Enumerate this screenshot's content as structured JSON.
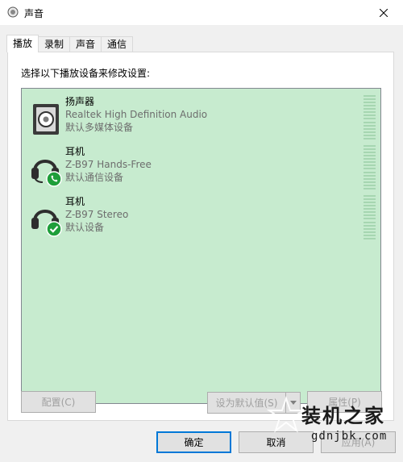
{
  "window": {
    "title": "声音"
  },
  "tabs": [
    {
      "label": "播放"
    },
    {
      "label": "录制"
    },
    {
      "label": "声音"
    },
    {
      "label": "通信"
    }
  ],
  "panel": {
    "instruction": "选择以下播放设备来修改设置:"
  },
  "devices": [
    {
      "name": "扬声器",
      "model": "Realtek High Definition Audio",
      "status": "默认多媒体设备",
      "icon": "speaker-icon"
    },
    {
      "name": "耳机",
      "model": "Z-B97 Hands-Free",
      "status": "默认通信设备",
      "icon": "headset-phone-icon"
    },
    {
      "name": "耳机",
      "model": "Z-B97 Stereo",
      "status": "默认设备",
      "icon": "headset-check-icon"
    }
  ],
  "buttons": {
    "configure": "配置(C)",
    "set_default": "设为默认值(S)",
    "properties": "属性(P)",
    "ok": "确定",
    "cancel": "取消",
    "apply": "应用(A)"
  },
  "watermark": {
    "title": "装机之家",
    "url": "gdnjbk.com"
  },
  "colors": {
    "list_bg": "#c7ebcf",
    "accent": "#0078d7",
    "badge_green": "#1e9e3a"
  }
}
